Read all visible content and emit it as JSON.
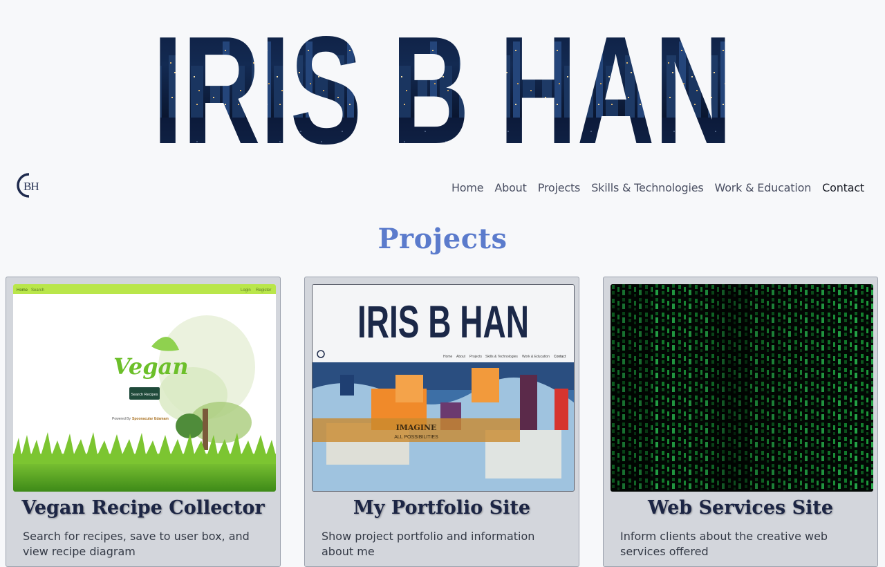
{
  "header": {
    "banner_text": "IRIS B HAN",
    "logo_text": "BH"
  },
  "nav": {
    "items": [
      {
        "label": "Home"
      },
      {
        "label": "About"
      },
      {
        "label": "Projects"
      },
      {
        "label": "Skills & Technologies"
      },
      {
        "label": "Work & Education"
      },
      {
        "label": "Contact"
      }
    ]
  },
  "projects": {
    "title": "Projects",
    "cards": [
      {
        "title": "Vegan Recipe Collector",
        "description": "Search for recipes, save to user box, and view recipe diagram",
        "thumb": {
          "nav_left": [
            "Home",
            "Search"
          ],
          "nav_right": [
            "Login",
            "Register"
          ],
          "logo_text": "Vegan",
          "button_label": "Search Recipes",
          "powered_by": "Powered By",
          "powered_1": "Spoonacular",
          "powered_2": "Edamam"
        }
      },
      {
        "title": "My Portfolio Site",
        "description": "Show project portfolio and information about me",
        "thumb": {
          "banner_text": "IRIS B HAN",
          "nav_items": [
            "Home",
            "About",
            "Projects",
            "Skills & Technologies",
            "Work & Education",
            "Contact"
          ],
          "overlay_title": "IMAGINE",
          "overlay_sub": "ALL POSSIBILITIES"
        }
      },
      {
        "title": "Web Services Site",
        "description": "Inform clients about the creative web services offered",
        "thumb": {}
      }
    ]
  },
  "colors": {
    "background": "#f7f8fa",
    "accent": "#5b7bcc",
    "banner_dark": "#0e1d3d",
    "card_bg": "#d3d6dc",
    "card_title": "#1c2544"
  }
}
